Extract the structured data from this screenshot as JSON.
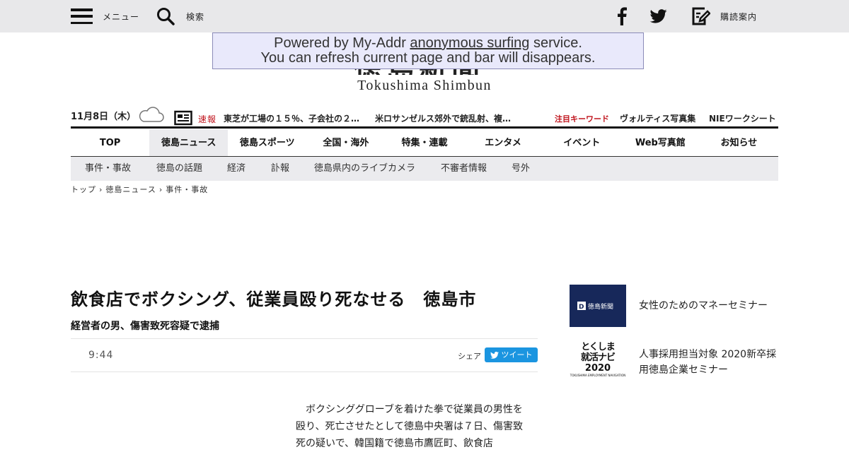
{
  "topbar": {
    "menu_label": "メニュー",
    "search_label": "検索",
    "subscribe_label": "購読案内"
  },
  "logo": {
    "jp": "徳島新聞",
    "en": "Tokushima Shimbun"
  },
  "proxy_banner": {
    "line1_pre": "Powered by My-Addr ",
    "line1_link": "anonymous surfing",
    "line1_post": " service.",
    "line2": "You can refresh current page and bar will disappears."
  },
  "ticker": {
    "date": "11月8日（木）",
    "breaking_label": "速報",
    "items": [
      "東芝が工場の１５％、子会社の２…",
      "米ロサンゼルス郊外で銃乱射、複…"
    ],
    "keyword_label": "注目キーワード",
    "keywords": [
      "ヴォルティス写真集",
      "NIEワークシート"
    ]
  },
  "main_nav": [
    {
      "label": "TOP"
    },
    {
      "label": "徳島ニュース"
    },
    {
      "label": "徳島スポーツ"
    },
    {
      "label": "全国・海外"
    },
    {
      "label": "特集・連載"
    },
    {
      "label": "エンタメ"
    },
    {
      "label": "イベント"
    },
    {
      "label": "Web写真館"
    },
    {
      "label": "お知らせ"
    }
  ],
  "sub_nav": [
    {
      "label": "事件・事故"
    },
    {
      "label": "徳島の話題"
    },
    {
      "label": "経済"
    },
    {
      "label": "訃報"
    },
    {
      "label": "徳島県内のライブカメラ"
    },
    {
      "label": "不審者情報"
    },
    {
      "label": "号外"
    }
  ],
  "breadcrumb": [
    "トップ",
    "徳島ニュース",
    "事件・事故"
  ],
  "article": {
    "headline": "飲食店でボクシング、従業員殴り死なせる　徳島市",
    "subhead": "経営者の男、傷害致死容疑で逮捕",
    "time": "9:44",
    "share_label": "シェア",
    "tweet_label": "ツイート",
    "body": "ボクシンググローブを着けた拳で従業員の男性を殴り、死亡させたとして徳島中央署は７日、傷害致死の疑いで、韓国籍で徳島市鷹匠町、飲食店"
  },
  "sidebar": [
    {
      "title": "女性のためのマネーセミナー",
      "thumb_text": "徳島新聞"
    },
    {
      "title": "人事採用担当対象 2020新卒採用徳島企業セミナー",
      "thumb_line1": "とくしま",
      "thumb_line2": "就活ナビ",
      "thumb_line3": "2020",
      "thumb_caption": "TOKUSHIMA EMPLOYMENT NAVIGATION"
    }
  ]
}
